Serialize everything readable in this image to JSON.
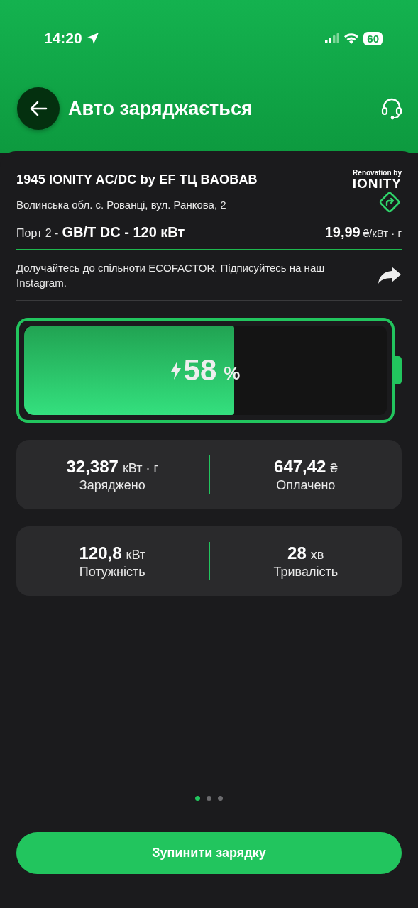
{
  "status_bar": {
    "time": "14:20",
    "battery": "60"
  },
  "header": {
    "title": "Авто заряджається"
  },
  "station": {
    "name": "1945 IONITY AC/DC by EF ТЦ BAOBAB",
    "logo_caption": "Renovation by",
    "logo_brand": "IONITY",
    "address": "Волинська обл. с. Рованці, вул. Ранкова, 2",
    "port_label": "Порт 2 -",
    "port_value": "GB/T DC - 120 кВт",
    "price": "19,99",
    "price_unit": "₴/кВт · г"
  },
  "promo": {
    "text": "Долучайтесь до спільноти ECOFACTOR. Підписуйтесь на наш Instagram."
  },
  "battery": {
    "level": 0.58,
    "value": "58",
    "unit": "%"
  },
  "stats": [
    {
      "items": [
        {
          "value": "32,387",
          "unit": "кВт · г",
          "label": "Заряджено"
        },
        {
          "value": "647,42",
          "unit": "₴",
          "label": "Оплачено"
        }
      ]
    },
    {
      "items": [
        {
          "value": "120,8",
          "unit": "кВт",
          "label": "Потужність"
        },
        {
          "value": "28",
          "unit": "хв",
          "label": "Тривалість"
        }
      ]
    }
  ],
  "pager": [
    {
      "selected": true
    },
    {
      "selected": false
    },
    {
      "selected": false
    }
  ],
  "stop_button": {
    "label": "Зупинити зарядку"
  }
}
